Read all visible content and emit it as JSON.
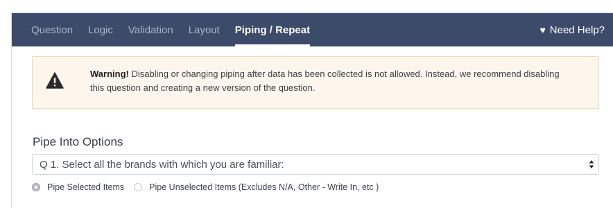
{
  "tabs": [
    {
      "label": "Question",
      "active": false
    },
    {
      "label": "Logic",
      "active": false
    },
    {
      "label": "Validation",
      "active": false
    },
    {
      "label": "Layout",
      "active": false
    },
    {
      "label": "Piping / Repeat",
      "active": true
    }
  ],
  "help": {
    "label": "Need Help?",
    "icon": "heart-icon"
  },
  "warning": {
    "icon": "warning-triangle-icon",
    "strong": "Warning!",
    "text": "Disabling or changing piping after data has been collected is not allowed. Instead, we recommend disabling this question and creating a new version of the question."
  },
  "pipe": {
    "title": "Pipe Into Options",
    "selected_question": "Q 1. Select all the brands with which you are familiar:",
    "options": [
      {
        "label": "Pipe Selected Items",
        "checked": true
      },
      {
        "label": "Pipe Unselected Items (Excludes N/A, Other - Write In, etc )",
        "checked": false
      }
    ]
  },
  "colors": {
    "tabbar": "#3d4b6b",
    "warning_bg": "#fdf6ec",
    "warning_border": "#f1d9b1"
  }
}
